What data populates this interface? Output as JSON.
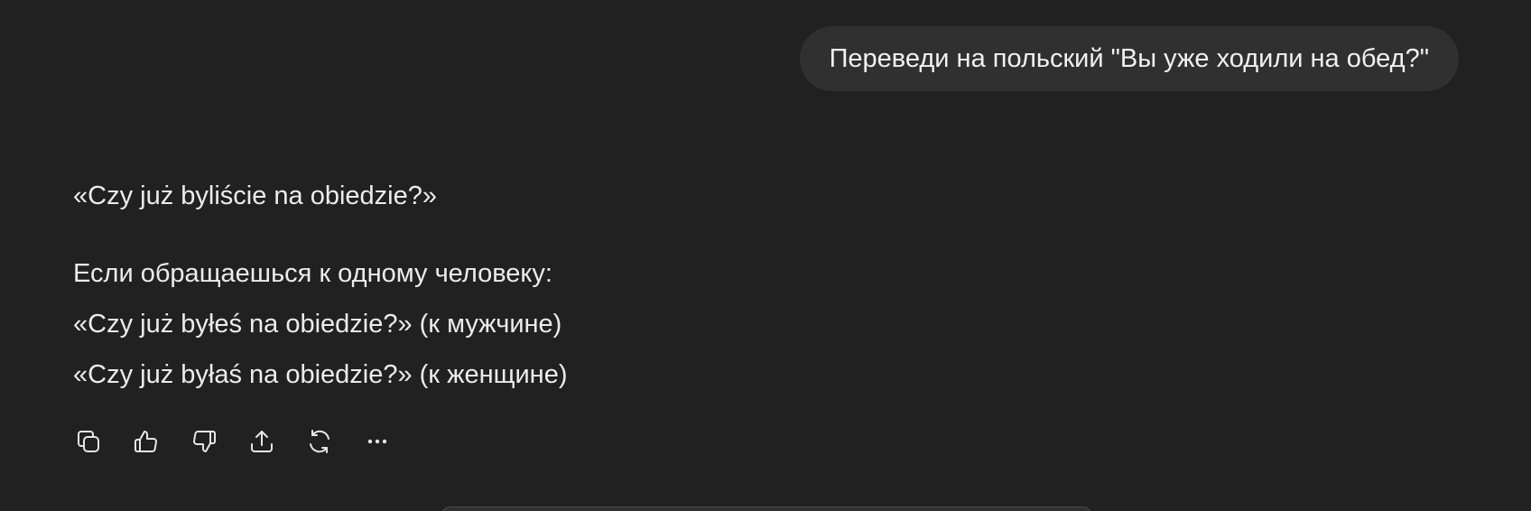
{
  "user_message": {
    "text": "Переведи на польский \"Вы уже ходили на обед?\""
  },
  "assistant_message": {
    "line1": "«Czy już byliście na obiedzie?»",
    "line2": "Если обращаешься к одному человеку:",
    "line3": "«Czy już byłeś na obiedzie?» (к мужчине)",
    "line4": "«Czy już byłaś na obiedzie?» (к женщине)"
  },
  "actions": [
    {
      "icon": "copy-icon"
    },
    {
      "icon": "thumbs-up-icon"
    },
    {
      "icon": "thumbs-down-icon"
    },
    {
      "icon": "share-icon"
    },
    {
      "icon": "regenerate-icon"
    },
    {
      "icon": "more-icon"
    }
  ],
  "colors": {
    "background": "#212121",
    "bubble": "#303030",
    "text": "#ececec"
  }
}
